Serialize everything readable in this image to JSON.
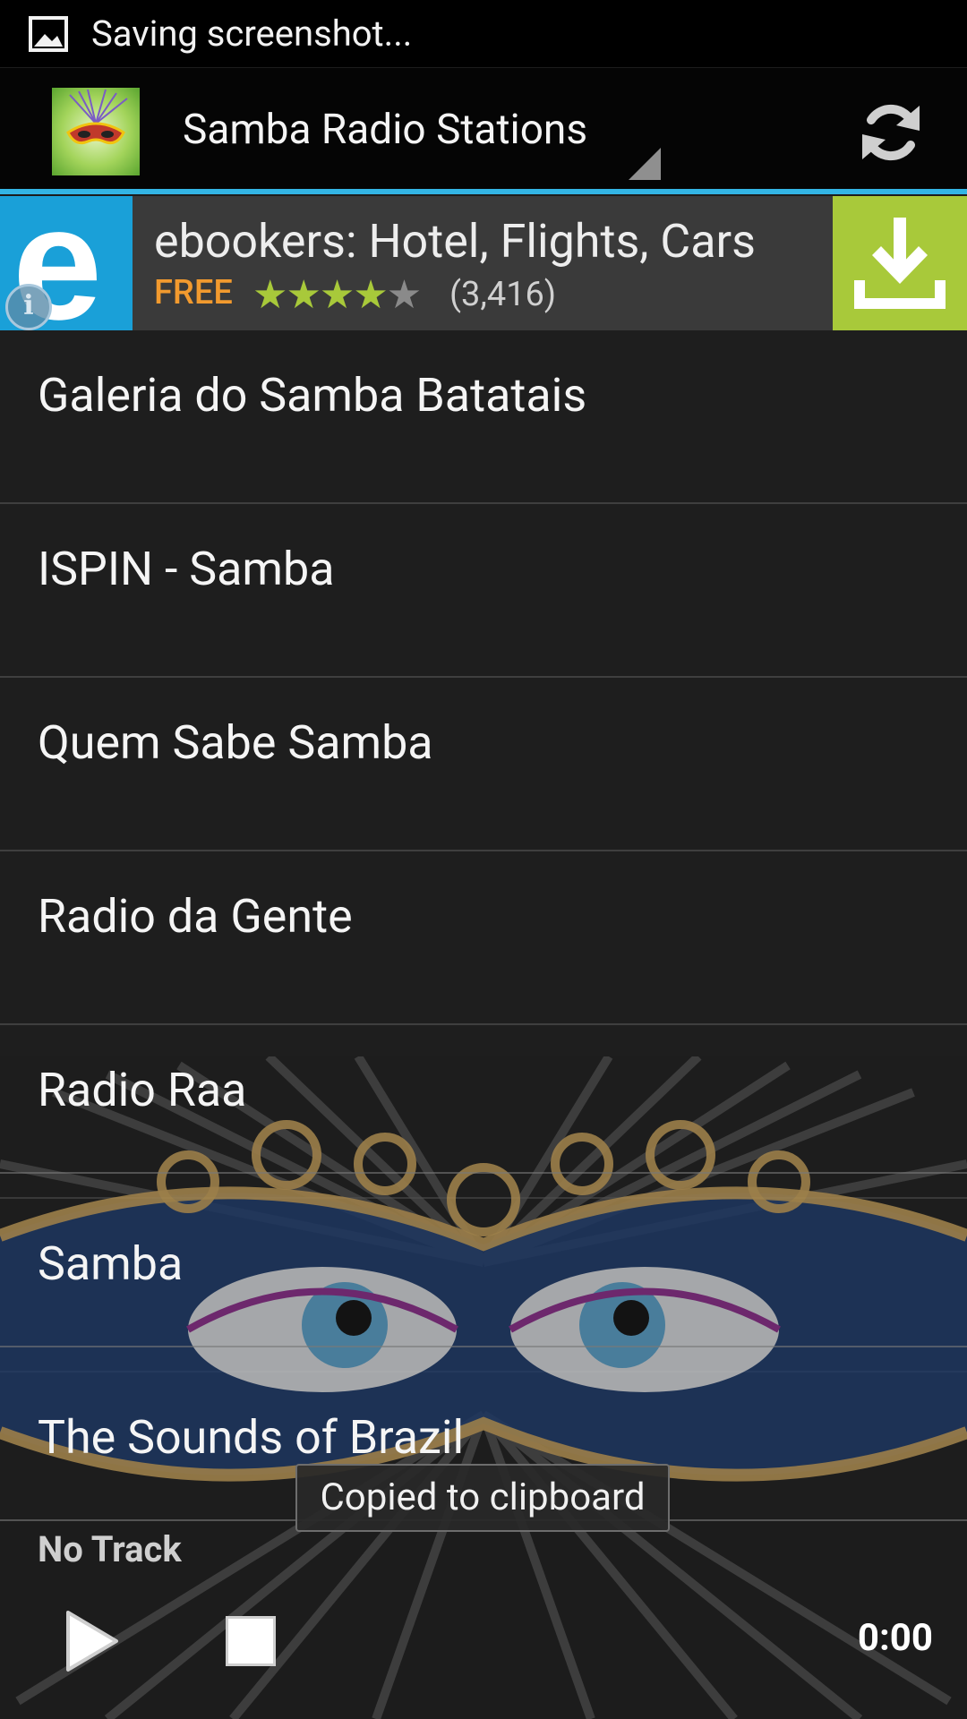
{
  "status_bar": {
    "text": "Saving screenshot..."
  },
  "action_bar": {
    "title": "Samba Radio Stations"
  },
  "ad": {
    "title": "ebookers: Hotel, Flights, Cars",
    "price": "FREE",
    "rating_stars": 4.5,
    "rating_count": "(3,416)",
    "logo_letter": "e",
    "info_glyph": "i"
  },
  "stations": [
    {
      "name": "Galeria do Samba Batatais"
    },
    {
      "name": "ISPIN - Samba"
    },
    {
      "name": "Quem Sabe Samba"
    },
    {
      "name": "Radio da Gente"
    },
    {
      "name": "Radio Raa"
    },
    {
      "name": "Samba"
    },
    {
      "name": "The Sounds of Brazil"
    }
  ],
  "toast": {
    "text": "Copied to clipboard"
  },
  "player": {
    "track": "No Track",
    "time": "0:00"
  },
  "colors": {
    "accent": "#33b5e5",
    "ad_green": "#a8c93a",
    "free_orange": "#f29a2e"
  }
}
